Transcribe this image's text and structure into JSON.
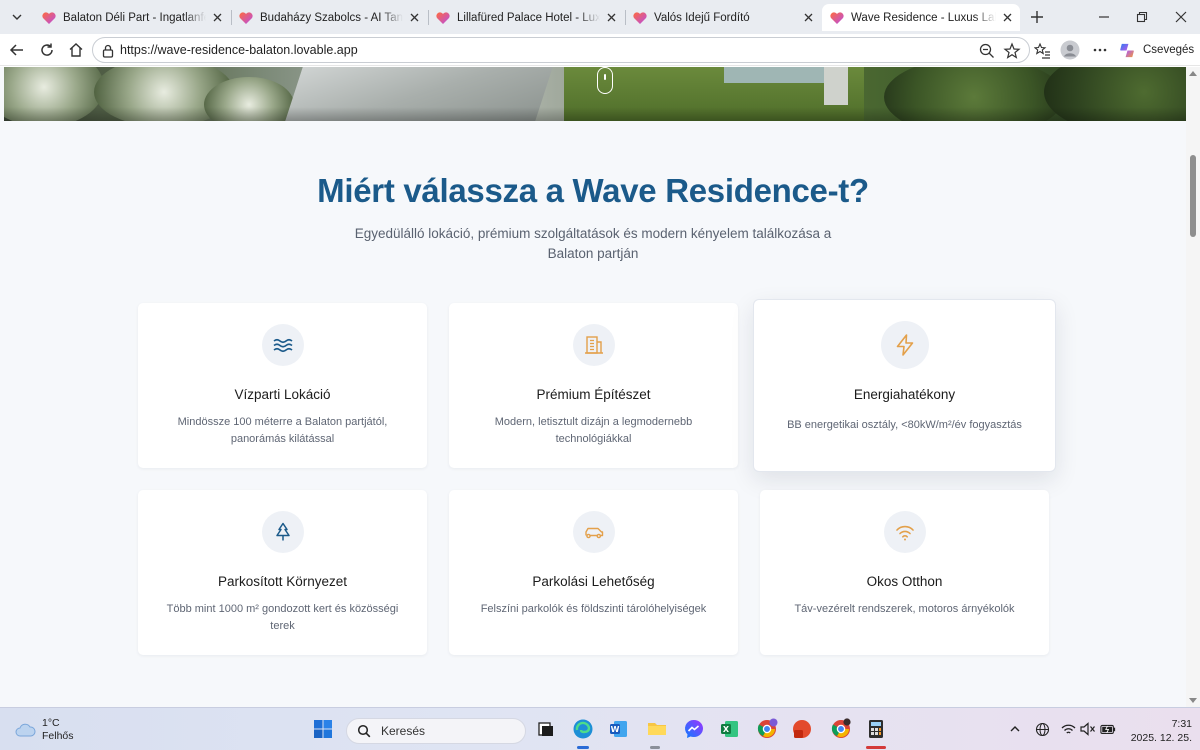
{
  "browser": {
    "tabs": [
      {
        "title": "Balaton Déli Part - Ingatlanfejlesztés"
      },
      {
        "title": "Budaházy Szabolcs - AI Tanácsadó"
      },
      {
        "title": "Lillafüred Palace Hotel - Luxury Hotel"
      },
      {
        "title": "Valós Idejű Fordító"
      },
      {
        "title": "Wave Residence - Luxus Lakások a Balatonon"
      }
    ],
    "active_tab": 4,
    "url": "https://wave-residence-balaton.lovable.app",
    "copilot_label": "Csevegés"
  },
  "page": {
    "heading": "Miért válassza a Wave Residence-t?",
    "subtitle": "Egyedülálló lokáció, prémium szolgáltatások és modern kényelem találkozása a Balaton partján",
    "colors": {
      "heading": "#1b5a8a",
      "accent_orange": "#e3a04a",
      "accent_blue": "#1b5a8a"
    },
    "features": [
      {
        "icon": "waves-icon",
        "title": "Vízparti Lokáció",
        "description": "Mindössze 100 méterre a Balaton partjától, panorámás kilátással"
      },
      {
        "icon": "building-icon",
        "title": "Prémium Építészet",
        "description": "Modern, letisztult dizájn a legmodernebb technológiákkal"
      },
      {
        "icon": "lightning-icon",
        "title": "Energiahatékony",
        "description": "BB energetikai osztály, <80kW/m²/év fogyasztás"
      },
      {
        "icon": "tree-icon",
        "title": "Parkosított Környezet",
        "description": "Több mint 1000 m² gondozott kert és közösségi terek"
      },
      {
        "icon": "car-icon",
        "title": "Parkolási Lehetőség",
        "description": "Felszíni parkolók és földszinti tárolóhelyiségek"
      },
      {
        "icon": "wifi-icon",
        "title": "Okos Otthon",
        "description": "Táv-vezérelt rendszerek, motoros árnyékolók"
      }
    ]
  },
  "taskbar": {
    "weather_temp": "1°C",
    "weather_desc": "Felhős",
    "search_placeholder": "Keresés",
    "time": "7:31",
    "date": "2025. 12. 25."
  }
}
